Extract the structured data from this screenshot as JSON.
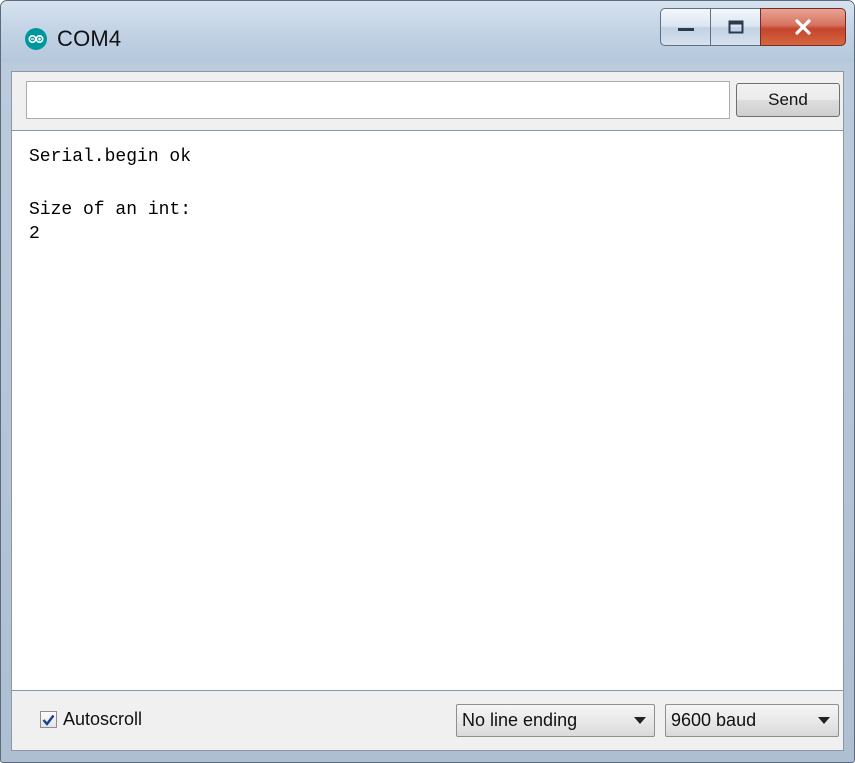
{
  "window": {
    "title": "COM4",
    "app_icon": "arduino-infinity-icon",
    "controls": [
      "minimize-icon",
      "maximize-icon",
      "close-icon"
    ]
  },
  "input": {
    "value": "",
    "send_label": "Send"
  },
  "output": {
    "lines": [
      "Serial.begin ok",
      "",
      "Size of an int:",
      "2"
    ]
  },
  "footer": {
    "autoscroll_label": "Autoscroll",
    "autoscroll_checked": true,
    "line_ending": "No line ending",
    "baud_rate": "9600 baud"
  },
  "colors": {
    "arduino_teal": "#00979c",
    "close_red": "#c5442d"
  }
}
